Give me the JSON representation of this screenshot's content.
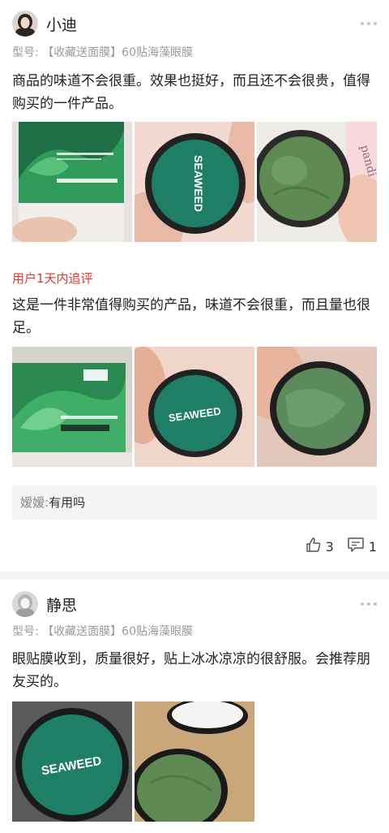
{
  "reviews": [
    {
      "username": "小迪",
      "sku_label": "型号:",
      "sku_value": "【收藏送面膜】60贴海藻眼膜",
      "text": "商品的味道不会很重。效果也挺好，而且还不会很贵，值得购买的一件产品。",
      "photos": [
        {
          "label": "SEAWEED"
        },
        {
          "label": "SEAWEED"
        },
        {
          "label": "pandi"
        }
      ],
      "followup": {
        "title": "用户1天内追评",
        "text": "这是一件非常值得购买的产品，味道不会很重，而且量也很足。",
        "photos": [
          {
            "label": ""
          },
          {
            "label": "SEAWEED"
          },
          {
            "label": ""
          }
        ]
      },
      "comment": {
        "name": "嫒嫒:",
        "text": "有用吗"
      },
      "likes": "3",
      "comments": "1"
    },
    {
      "username": "静思",
      "sku_label": "型号:",
      "sku_value": "【收藏送面膜】60贴海藻眼膜",
      "text": "眼贴膜收到，质量很好，贴上冰冰凉凉的很舒服。会推荐朋友买的。",
      "photos": [
        {
          "label": "SEAWEED"
        },
        {
          "label": ""
        }
      ]
    }
  ],
  "colors": {
    "followup_red": "#e8372c",
    "muted_gray": "#9a9a9a",
    "jar_teal": "#1f7f66",
    "gel_green": "#5f8a54"
  }
}
